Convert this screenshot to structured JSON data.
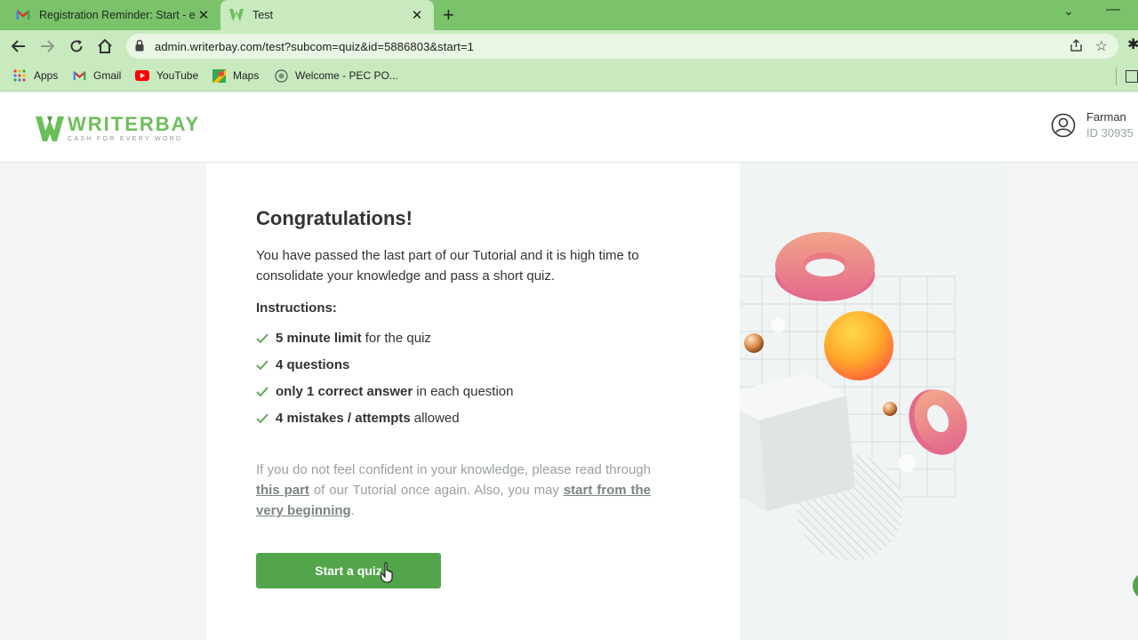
{
  "browser": {
    "tabs": [
      {
        "title": "Registration Reminder: Start - en",
        "active": false
      },
      {
        "title": "Test",
        "active": true
      }
    ],
    "url": "admin.writerbay.com/test?subcom=quiz&id=5886803&start=1",
    "bookmarks": [
      "Apps",
      "Gmail",
      "YouTube",
      "Maps",
      "Welcome - PEC PO..."
    ]
  },
  "header": {
    "logo_name": "WRITERBAY",
    "logo_tagline": "CASH FOR EVERY WORD",
    "user_name": "Farman",
    "user_id": "ID 30935"
  },
  "main": {
    "title": "Congratulations!",
    "intro": "You have passed the last part of our Tutorial and it is high time to consolidate your knowledge and pass a short quiz.",
    "instructions_heading": "Instructions:",
    "instructions": [
      {
        "bold": "5 minute limit",
        "rest": "for the quiz"
      },
      {
        "bold": "4 questions",
        "rest": ""
      },
      {
        "bold": "only 1 correct answer",
        "rest": "in each question"
      },
      {
        "bold": "4 mistakes / attempts",
        "rest": "allowed"
      }
    ],
    "note_part1": "If you do not feel confident in your knowledge, please read through",
    "note_link1": "this part",
    "note_part2": "of our Tutorial once again. Also, you may",
    "note_link2": "start from the very beginning",
    "note_part3": ".",
    "button_label": "Start a quiz"
  },
  "colors": {
    "chrome_green": "#7ac36a",
    "brand_green": "#6bbf5b",
    "button_green": "#53a54b"
  }
}
